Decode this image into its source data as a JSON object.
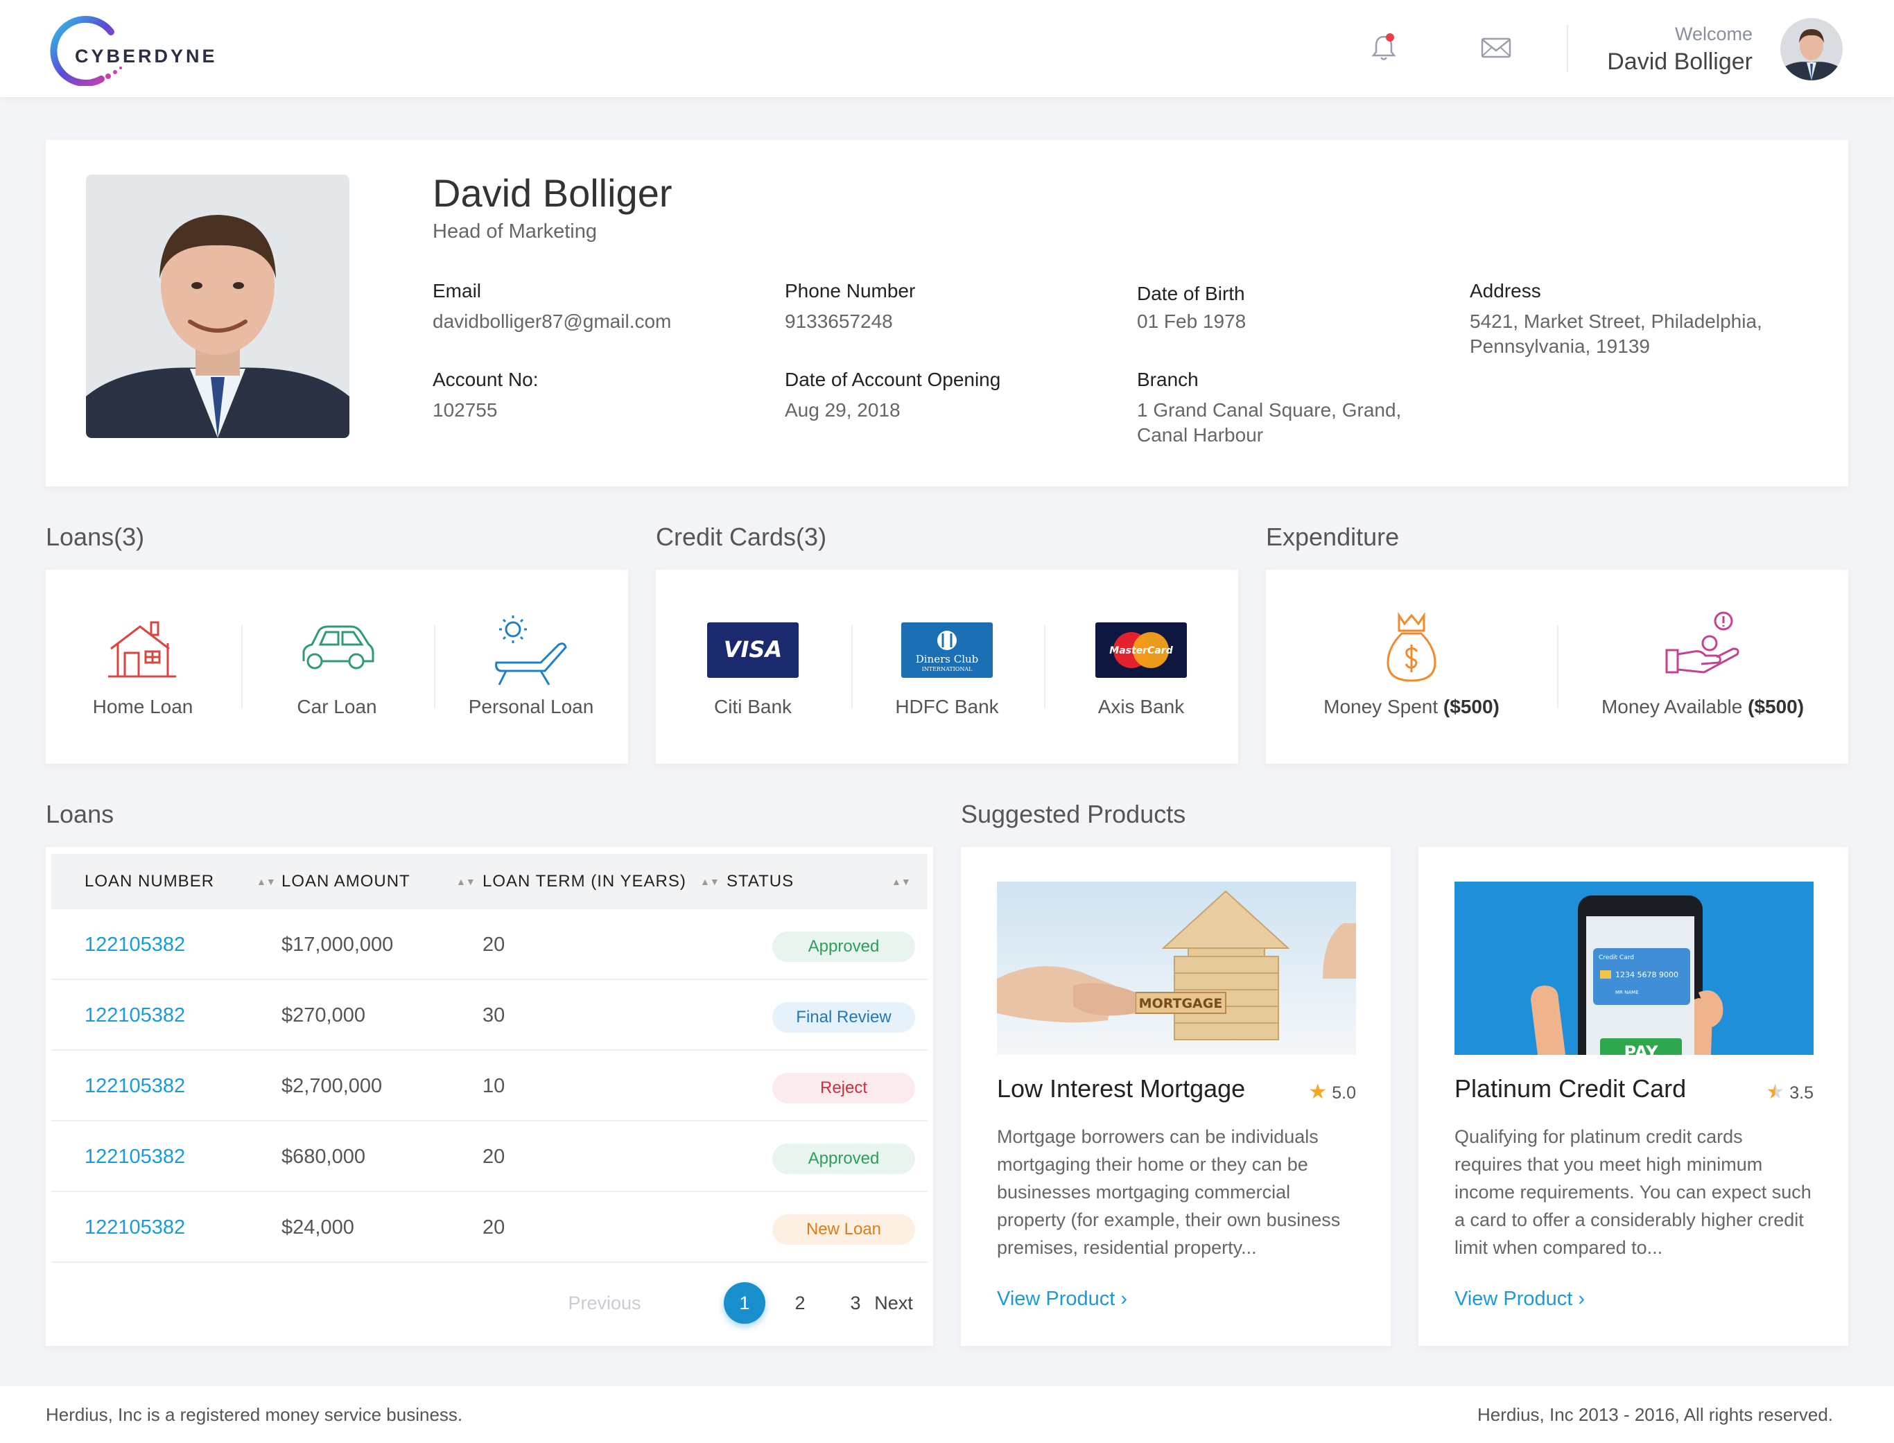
{
  "header": {
    "brand": "CYBERDYNE",
    "welcome_label": "Welcome",
    "user_name": "David Bolliger",
    "icons": [
      "bell-icon",
      "mail-icon"
    ]
  },
  "profile": {
    "name": "David Bolliger",
    "role": "Head of Marketing",
    "fields": {
      "email": {
        "label": "Email",
        "value": "davidbolliger87@gmail.com"
      },
      "phone": {
        "label": "Phone Number",
        "value": "9133657248"
      },
      "dob": {
        "label": "Date of Birth",
        "value": "01 Feb 1978"
      },
      "address": {
        "label": "Address",
        "value": "5421, Market Street, Philadelphia, Pennsylvania, 19139"
      },
      "account": {
        "label": "Account No:",
        "value": "102755"
      },
      "opening": {
        "label": "Date of Account Opening",
        "value": "Aug 29, 2018"
      },
      "branch": {
        "label": "Branch",
        "value": "1 Grand Canal Square, Grand, Canal Harbour"
      }
    }
  },
  "loans_summary": {
    "title": "Loans(3)",
    "items": [
      {
        "label": "Home Loan",
        "icon": "house-icon"
      },
      {
        "label": "Car Loan",
        "icon": "car-icon"
      },
      {
        "label": "Personal Loan",
        "icon": "beach-chair-icon"
      }
    ]
  },
  "cards_summary": {
    "title": "Credit Cards(3)",
    "items": [
      {
        "label": "Citi Bank",
        "icon": "visa-logo",
        "logo_text": "VISA"
      },
      {
        "label": "HDFC Bank",
        "icon": "diners-club-logo",
        "logo_text": "Diners Club",
        "logo_sub": "INTERNATIONAL"
      },
      {
        "label": "Axis Bank",
        "icon": "mastercard-logo",
        "logo_text": "MasterCard"
      }
    ]
  },
  "expenditure": {
    "title": "Expenditure",
    "items": [
      {
        "label": "Money Spent",
        "amount": "($500)",
        "icon": "money-bag-icon"
      },
      {
        "label": "Money Available",
        "amount": "($500)",
        "icon": "hand-coins-icon"
      }
    ]
  },
  "loans_table": {
    "title": "Loans",
    "columns": [
      "LOAN NUMBER",
      "LOAN AMOUNT",
      "LOAN TERM (IN YEARS)",
      "STATUS"
    ],
    "rows": [
      {
        "number": "122105382",
        "amount": "$17,000,000",
        "term": "20",
        "status": "Approved"
      },
      {
        "number": "122105382",
        "amount": "$270,000",
        "term": "30",
        "status": "Final Review"
      },
      {
        "number": "122105382",
        "amount": "$2,700,000",
        "term": "10",
        "status": "Reject"
      },
      {
        "number": "122105382",
        "amount": "$680,000",
        "term": "20",
        "status": "Approved"
      },
      {
        "number": "122105382",
        "amount": "$24,000",
        "term": "20",
        "status": "New Loan"
      }
    ],
    "pagination": {
      "previous": "Previous",
      "pages": [
        "1",
        "2",
        "3"
      ],
      "current": "1",
      "next": "Next"
    }
  },
  "status_colors": {
    "Approved": {
      "bg": "#e8f5ee",
      "fg": "#2e9e5b"
    },
    "Final Review": {
      "bg": "#e6f2fb",
      "fg": "#2477b8"
    },
    "Reject": {
      "bg": "#fcebed",
      "fg": "#c9303f"
    },
    "New Loan": {
      "bg": "#fdf0e2",
      "fg": "#e07b1a"
    }
  },
  "suggested": {
    "title": "Suggested Products",
    "products": [
      {
        "title": "Low Interest Mortgage",
        "rating": "5.0",
        "rating_value": 5.0,
        "description": "Mortgage borrowers can be individuals mortgaging their home or they can be businesses mortgaging commercial property (for example, their own business premises, residential property...",
        "link": "View Product",
        "image_label": "MORTGAGE"
      },
      {
        "title": "Platinum Credit Card",
        "rating": "3.5",
        "rating_value": 3.5,
        "description": "Qualifying for platinum credit cards requires that you meet high minimum income requirements. You can expect such a card to offer a considerably higher credit limit when compared to...",
        "link": "View Product",
        "image_label": "PAY",
        "card_number": "1234 5678 9000",
        "card_caption": "Credit Card",
        "card_holder": "MR NAME"
      }
    ]
  },
  "footer": {
    "left": "Herdius, Inc is a registered money service business.",
    "right": "Herdius, Inc 2013 - 2016, All rights reserved."
  }
}
